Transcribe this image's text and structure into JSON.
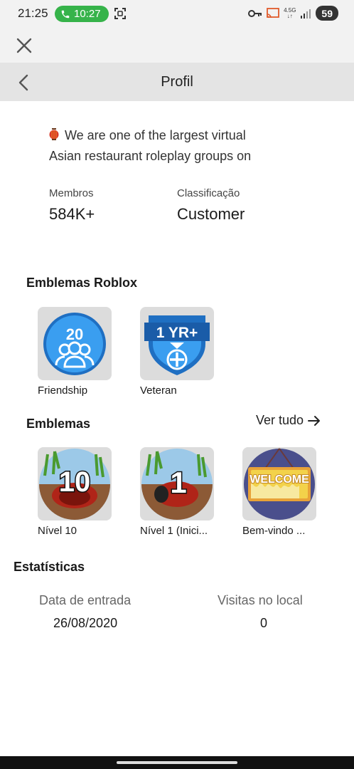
{
  "status_bar": {
    "time": "21:25",
    "call_time": "10:27",
    "net_top": "4.5G",
    "net_bottom": "↓↑",
    "battery": "59"
  },
  "header": {
    "title": "Profil"
  },
  "description": {
    "line1": "We are one of the largest virtual",
    "line2": "Asian restaurant roleplay groups on"
  },
  "stats": {
    "members_label": "Membros",
    "members_value": "584K+",
    "rank_label": "Classificação",
    "rank_value": "Customer"
  },
  "roblox_badges": {
    "title": "Emblemas Roblox",
    "items": [
      {
        "name": "Friendship",
        "icon": "friendship-badge-icon",
        "number": "20"
      },
      {
        "name": "Veteran",
        "icon": "veteran-badge-icon",
        "number": "1 YR+"
      }
    ]
  },
  "badges": {
    "title": "Emblemas",
    "see_all": "Ver tudo",
    "items": [
      {
        "name": "Nível 10",
        "icon": "level-10-badge-icon",
        "number": "10"
      },
      {
        "name": "Nível 1 (Inici...",
        "icon": "level-1-badge-icon",
        "number": "1"
      },
      {
        "name": "Bem-vindo ...",
        "icon": "welcome-badge-icon",
        "sign": "WELCOME"
      }
    ]
  },
  "statistics": {
    "title": "Estatísticas",
    "join_label": "Data de entrada",
    "join_value": "26/08/2020",
    "visits_label": "Visitas no local",
    "visits_value": "0"
  },
  "colors": {
    "status_bar_bg": "#f2f2f2",
    "header_bg": "#e4e4e4",
    "badge_tile_bg": "#dcdcdc",
    "call_green": "#36b34a",
    "roblox_blue": "#2b8fe0"
  }
}
